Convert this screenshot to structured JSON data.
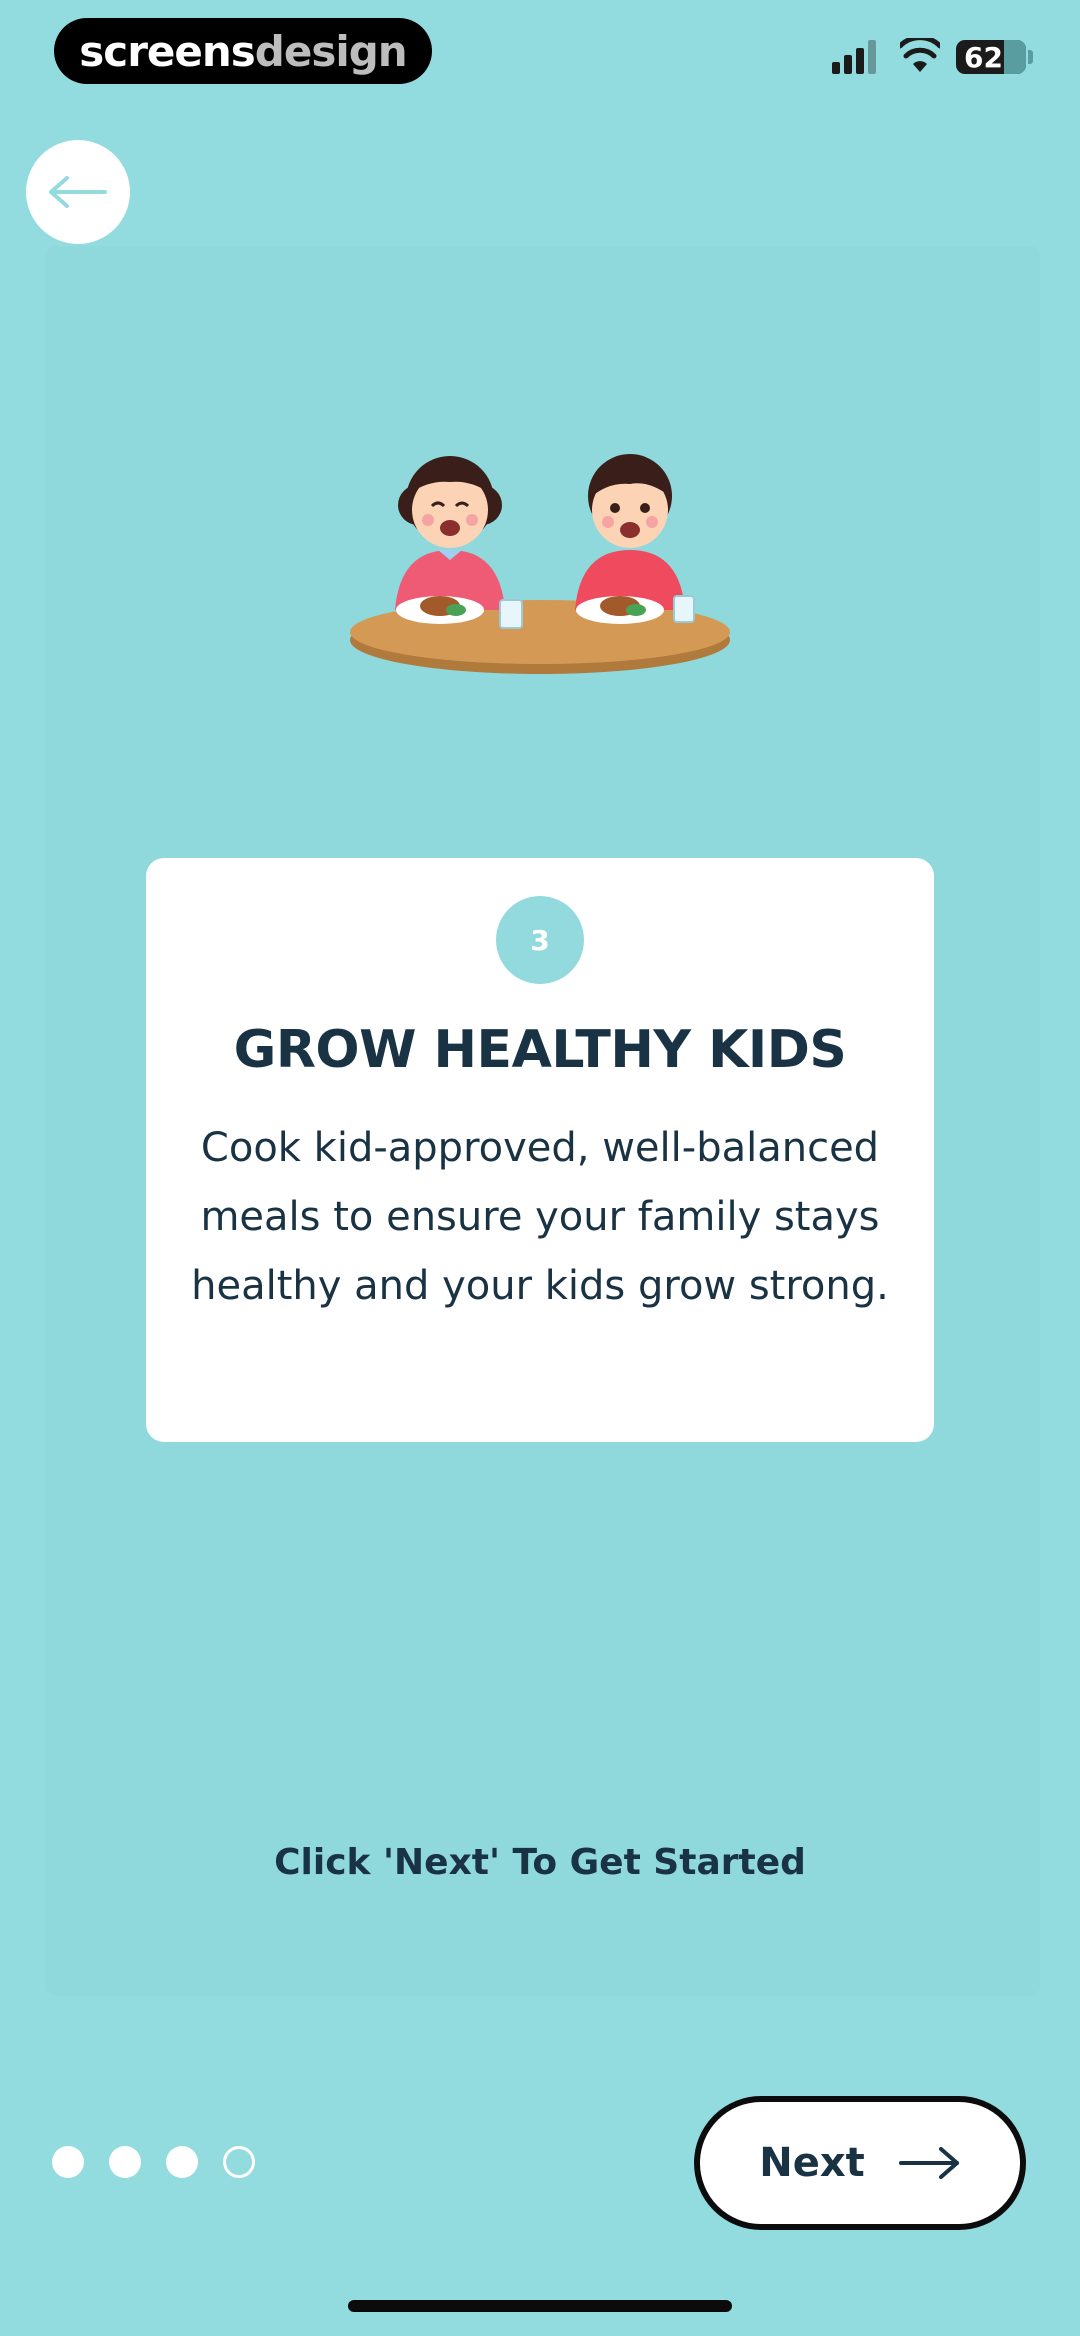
{
  "status_bar": {
    "brand_part1": "screens",
    "brand_part2": "design",
    "battery": "62"
  },
  "onboarding": {
    "step_number": "3",
    "title": "GROW HEALTHY KIDS",
    "description": "Cook kid-approved, well-balanced meals to ensure your family stays healthy and your kids grow strong.",
    "hint": "Click 'Next' To Get Started"
  },
  "pagination": {
    "total": 4,
    "active_index": 3
  },
  "actions": {
    "next_label": "Next"
  },
  "colors": {
    "background": "#92dbdf",
    "text": "#1a3344",
    "card": "#ffffff"
  }
}
